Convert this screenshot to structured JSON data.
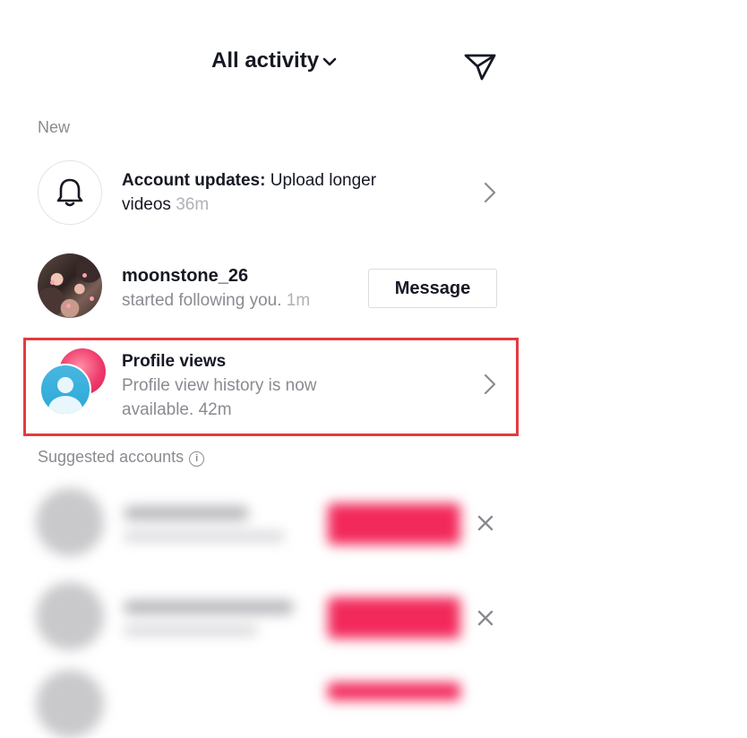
{
  "header": {
    "title": "All activity",
    "title_icon": "chevron-down-icon",
    "action_icon": "send-icon"
  },
  "sections": {
    "new_label": "New",
    "suggested_label": "Suggested accounts",
    "suggested_info_icon": "i"
  },
  "notifications": [
    {
      "icon": "bell-icon",
      "title": "Account updates:",
      "text_line1": "Upload longer",
      "text_line2": "videos",
      "time": "36m",
      "action_icon": "chevron-right-icon"
    },
    {
      "icon": "avatar-photo",
      "username": "moonstone_26",
      "text": "started following you.",
      "time": "1m",
      "button": "Message"
    },
    {
      "icon": "profile-views-icon",
      "title": "Profile views",
      "text_line1": "Profile view history is now",
      "text_line2": "available.",
      "time": "42m",
      "action_icon": "chevron-right-icon",
      "highlighted": true
    }
  ],
  "colors": {
    "accent": "#f2295b",
    "highlight": "#e43a3f",
    "muted_text": "#8a8b91"
  }
}
